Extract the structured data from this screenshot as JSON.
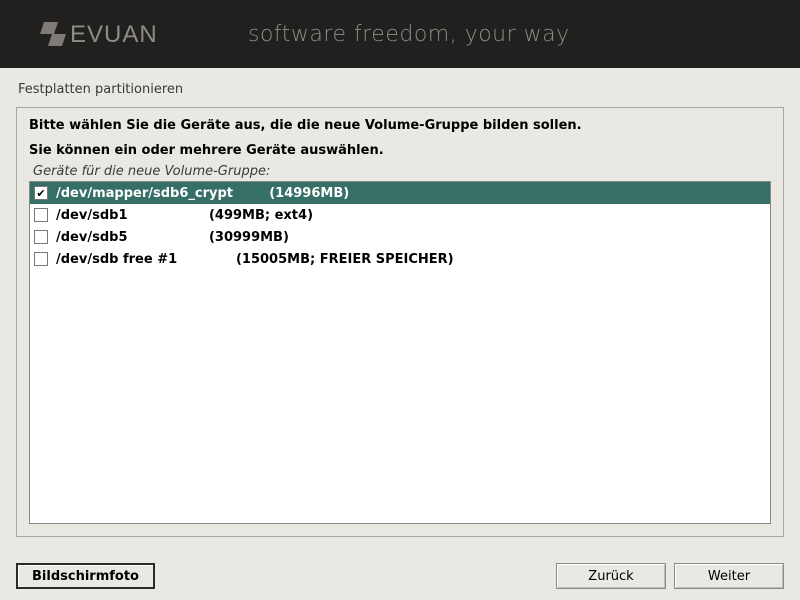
{
  "header": {
    "tagline": "software freedom, your way"
  },
  "page_title": "Festplatten partitionieren",
  "instruction": "Bitte wählen Sie die Geräte aus, die die neue Volume-Gruppe bilden sollen.",
  "subinstruction": "Sie können ein oder mehrere Geräte auswählen.",
  "list_label": "Geräte für die neue Volume-Gruppe:",
  "devices": [
    {
      "checked": true,
      "selected": true,
      "text": "/dev/mapper/sdb6_crypt        (14996MB)"
    },
    {
      "checked": false,
      "selected": false,
      "text": "/dev/sdb1                  (499MB; ext4)"
    },
    {
      "checked": false,
      "selected": false,
      "text": "/dev/sdb5                  (30999MB)"
    },
    {
      "checked": false,
      "selected": false,
      "text": "/dev/sdb free #1             (15005MB; FREIER SPEICHER)"
    }
  ],
  "footer": {
    "screenshot": "Bildschirmfoto",
    "back": "Zurück",
    "continue": "Weiter"
  }
}
